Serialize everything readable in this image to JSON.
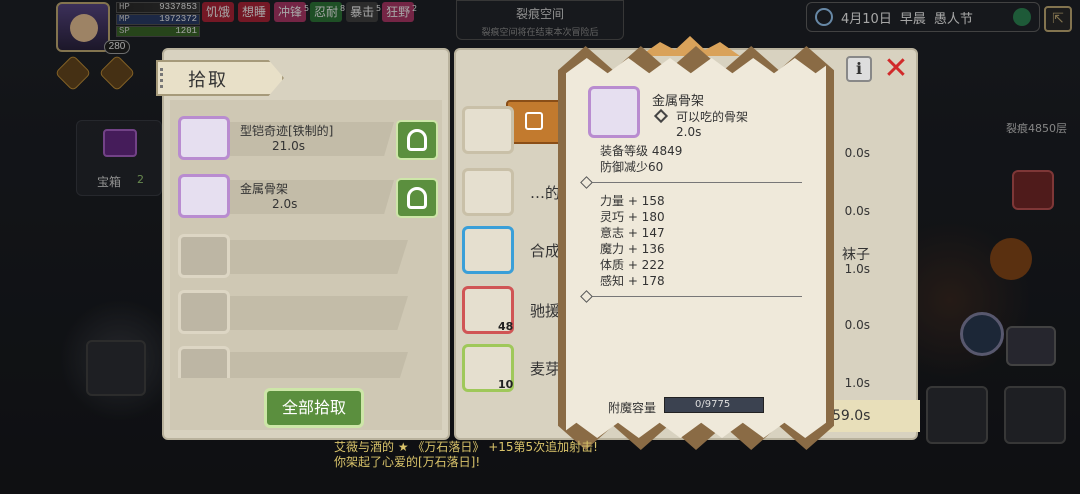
{
  "hud": {
    "hp_label": "HP",
    "hp_value": "9337853",
    "mp_label": "MP",
    "mp_value": "1972372",
    "sp_label": "SP",
    "sp_value": "1201",
    "level": "280",
    "buffs": [
      {
        "label": "饥饿",
        "count": "",
        "color": "#b3263a"
      },
      {
        "label": "想睡",
        "count": "",
        "color": "#b3263a"
      },
      {
        "label": "冲锋",
        "count": "5",
        "color": "#b33a6a"
      },
      {
        "label": "忍耐",
        "count": "8",
        "color": "#2f7a3a"
      },
      {
        "label": "暴击",
        "count": "5",
        "color": "#444"
      },
      {
        "label": "狂野",
        "count": "2",
        "color": "#b33a6a"
      }
    ]
  },
  "rift": {
    "title": "裂痕空间",
    "subtitle": "裂痕空间将在结束本次冒险后"
  },
  "date": {
    "text": "4月10日",
    "period": "早晨",
    "event": "愚人节"
  },
  "side": {
    "chest_label": "宝箱",
    "chest_count": "2",
    "rift_floor": "裂痕4850层"
  },
  "pickup": {
    "title": "拾取",
    "items": [
      {
        "name": "型铠奇迹[铁制的]",
        "time": "21.0s"
      },
      {
        "name": "金属骨架",
        "time": "2.0s"
      }
    ],
    "pick_all": "全部拾取"
  },
  "inventory": {
    "rows": [
      {
        "label": "",
        "right": "0.0s",
        "count": ""
      },
      {
        "label": "…的装",
        "right": "0.0s",
        "count": ""
      },
      {
        "label": "合成",
        "right": "1.0s",
        "extra": "袜子",
        "count": ""
      },
      {
        "label": "驰援",
        "right": "0.0s",
        "count": "48"
      },
      {
        "label": "麦芽",
        "right": "1.0s",
        "count": "10"
      }
    ],
    "total_time": "59.0s"
  },
  "tooltip": {
    "name": "金属骨架",
    "edible": "可以吃的骨架",
    "time": "2.0s",
    "equip_level": "装备等级 4849",
    "defense": "防御减少60",
    "stats": [
      "力量 + 158",
      "灵巧 + 180",
      "意志 + 147",
      "魔力 + 136",
      "体质 + 222",
      "感知 + 178"
    ],
    "enchant_label": "附魔容量",
    "enchant_value": "0/9775"
  },
  "chat": {
    "line1": "艾薇与酒的 ★ 《万石落日》 +15第5次追加射击!",
    "line2": "你架起了心爱的[万石落日]!"
  },
  "colors": {
    "accent_green": "#5b8f3e",
    "rarity_purple": "#b98cd0",
    "paper": "#efe9da"
  }
}
